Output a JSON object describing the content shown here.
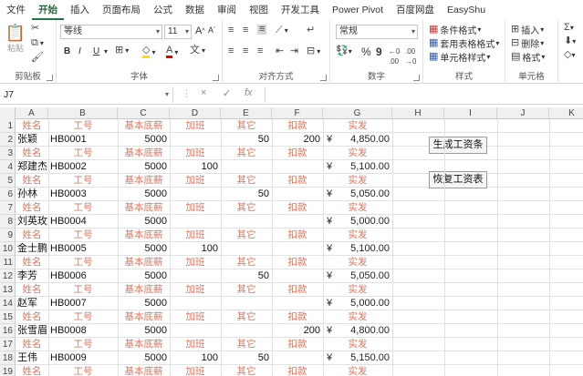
{
  "menu": [
    "文件",
    "开始",
    "插入",
    "页面布局",
    "公式",
    "数据",
    "审阅",
    "视图",
    "开发工具",
    "Power Pivot",
    "百度网盘",
    "EasyShu"
  ],
  "active_menu": "开始",
  "ribbon": {
    "clipboard": {
      "label": "剪贴板",
      "paste": "粘贴"
    },
    "font": {
      "label": "字体",
      "font_name": "等线",
      "font_size": "11",
      "bold": "B",
      "italic": "I",
      "underline": "U",
      "grow": "A",
      "shrink": "A"
    },
    "alignment": {
      "label": "对齐方式"
    },
    "number": {
      "label": "数字",
      "format": "常规",
      "percent": "%",
      "comma": "9"
    },
    "styles": {
      "label": "样式",
      "conditional": "条件格式",
      "table": "套用表格格式",
      "cell_styles": "单元格样式"
    },
    "cells": {
      "label": "单元格",
      "insert": "插入",
      "delete": "删除",
      "format": "格式"
    }
  },
  "formula_bar": {
    "name_box": "J7",
    "cancel": "×",
    "confirm": "✓",
    "fx": "fx",
    "value": ""
  },
  "columns": [
    "A",
    "B",
    "C",
    "D",
    "E",
    "F",
    "G",
    "H",
    "I",
    "J",
    "K"
  ],
  "header_labels": [
    "姓名",
    "工号",
    "基本底薪",
    "加班",
    "其它",
    "扣款",
    "实发"
  ],
  "records": [
    {
      "name": "张颖",
      "id": "HB0001",
      "base": "5000",
      "overtime": "",
      "other": "50",
      "deduct": "200",
      "currency": "¥",
      "salary": "4,850.00"
    },
    {
      "name": "郑建杰",
      "id": "HB0002",
      "base": "5000",
      "overtime": "100",
      "other": "",
      "deduct": "",
      "currency": "¥",
      "salary": "5,100.00"
    },
    {
      "name": "孙林",
      "id": "HB0003",
      "base": "5000",
      "overtime": "",
      "other": "50",
      "deduct": "",
      "currency": "¥",
      "salary": "5,050.00"
    },
    {
      "name": "刘英玫",
      "id": "HB0004",
      "base": "5000",
      "overtime": "",
      "other": "",
      "deduct": "",
      "currency": "¥",
      "salary": "5,000.00"
    },
    {
      "name": "金士鹏",
      "id": "HB0005",
      "base": "5000",
      "overtime": "100",
      "other": "",
      "deduct": "",
      "currency": "¥",
      "salary": "5,100.00"
    },
    {
      "name": "李芳",
      "id": "HB0006",
      "base": "5000",
      "overtime": "",
      "other": "50",
      "deduct": "",
      "currency": "¥",
      "salary": "5,050.00"
    },
    {
      "name": "赵军",
      "id": "HB0007",
      "base": "5000",
      "overtime": "",
      "other": "",
      "deduct": "",
      "currency": "¥",
      "salary": "5,000.00"
    },
    {
      "name": "张雪眉",
      "id": "HB0008",
      "base": "5000",
      "overtime": "",
      "other": "",
      "deduct": "200",
      "currency": "¥",
      "salary": "4,800.00"
    },
    {
      "name": "王伟",
      "id": "HB0009",
      "base": "5000",
      "overtime": "100",
      "other": "50",
      "deduct": "",
      "currency": "¥",
      "salary": "5,150.00"
    }
  ],
  "buttons": {
    "generate": "生成工资条",
    "restore": "恢复工资表"
  },
  "colors": {
    "accent": "#217346",
    "header_text": "#e2735a"
  }
}
